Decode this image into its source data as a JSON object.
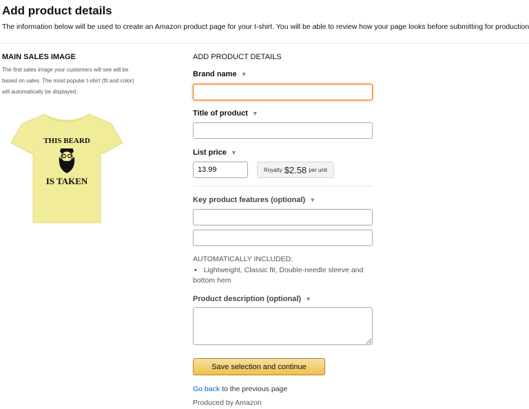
{
  "header": {
    "title": "Add product details",
    "intro": "The information below will be used to create an Amazon product page for your t-shirt. You will be able to review how your page looks before submitting for production."
  },
  "left": {
    "title": "MAIN SALES IMAGE",
    "description": "The first sales image your customers will see will be based on sales. The most popular t-shirt (fit and color) will automatically be displayed.",
    "shirt": {
      "line1": "THIS BEARD",
      "line2": "IS TAKEN",
      "color": "#f1ec9a"
    }
  },
  "form": {
    "title": "ADD PRODUCT DETAILS",
    "brand_label": "Brand name",
    "brand_value": "",
    "title_label": "Title of product",
    "title_value": "",
    "price_label": "List price",
    "price_value": "13.99",
    "royalty_label": "Royalty",
    "royalty_amount": "$2.58",
    "royalty_unit": "per unit",
    "features_label": "Key product features (optional)",
    "feature1_value": "",
    "feature2_value": "",
    "auto_title": "AUTOMATICALLY INCLUDED:",
    "auto_bullet": "•",
    "auto_item": "Lightweight, Classic fit, Double-needle sleeve and bottom hem",
    "description_label": "Product description (optional)",
    "description_value": "",
    "caret": "▼"
  },
  "actions": {
    "save_label": "Save selection and continue",
    "goback_link": "Go back",
    "goback_rest": " to the previous page",
    "produced_by": "Produced by Amazon"
  },
  "colors": {
    "focus_border": "#e77600",
    "link": "#0066c0",
    "button_top": "#f7dfa5",
    "button_bottom": "#f0c14b"
  }
}
